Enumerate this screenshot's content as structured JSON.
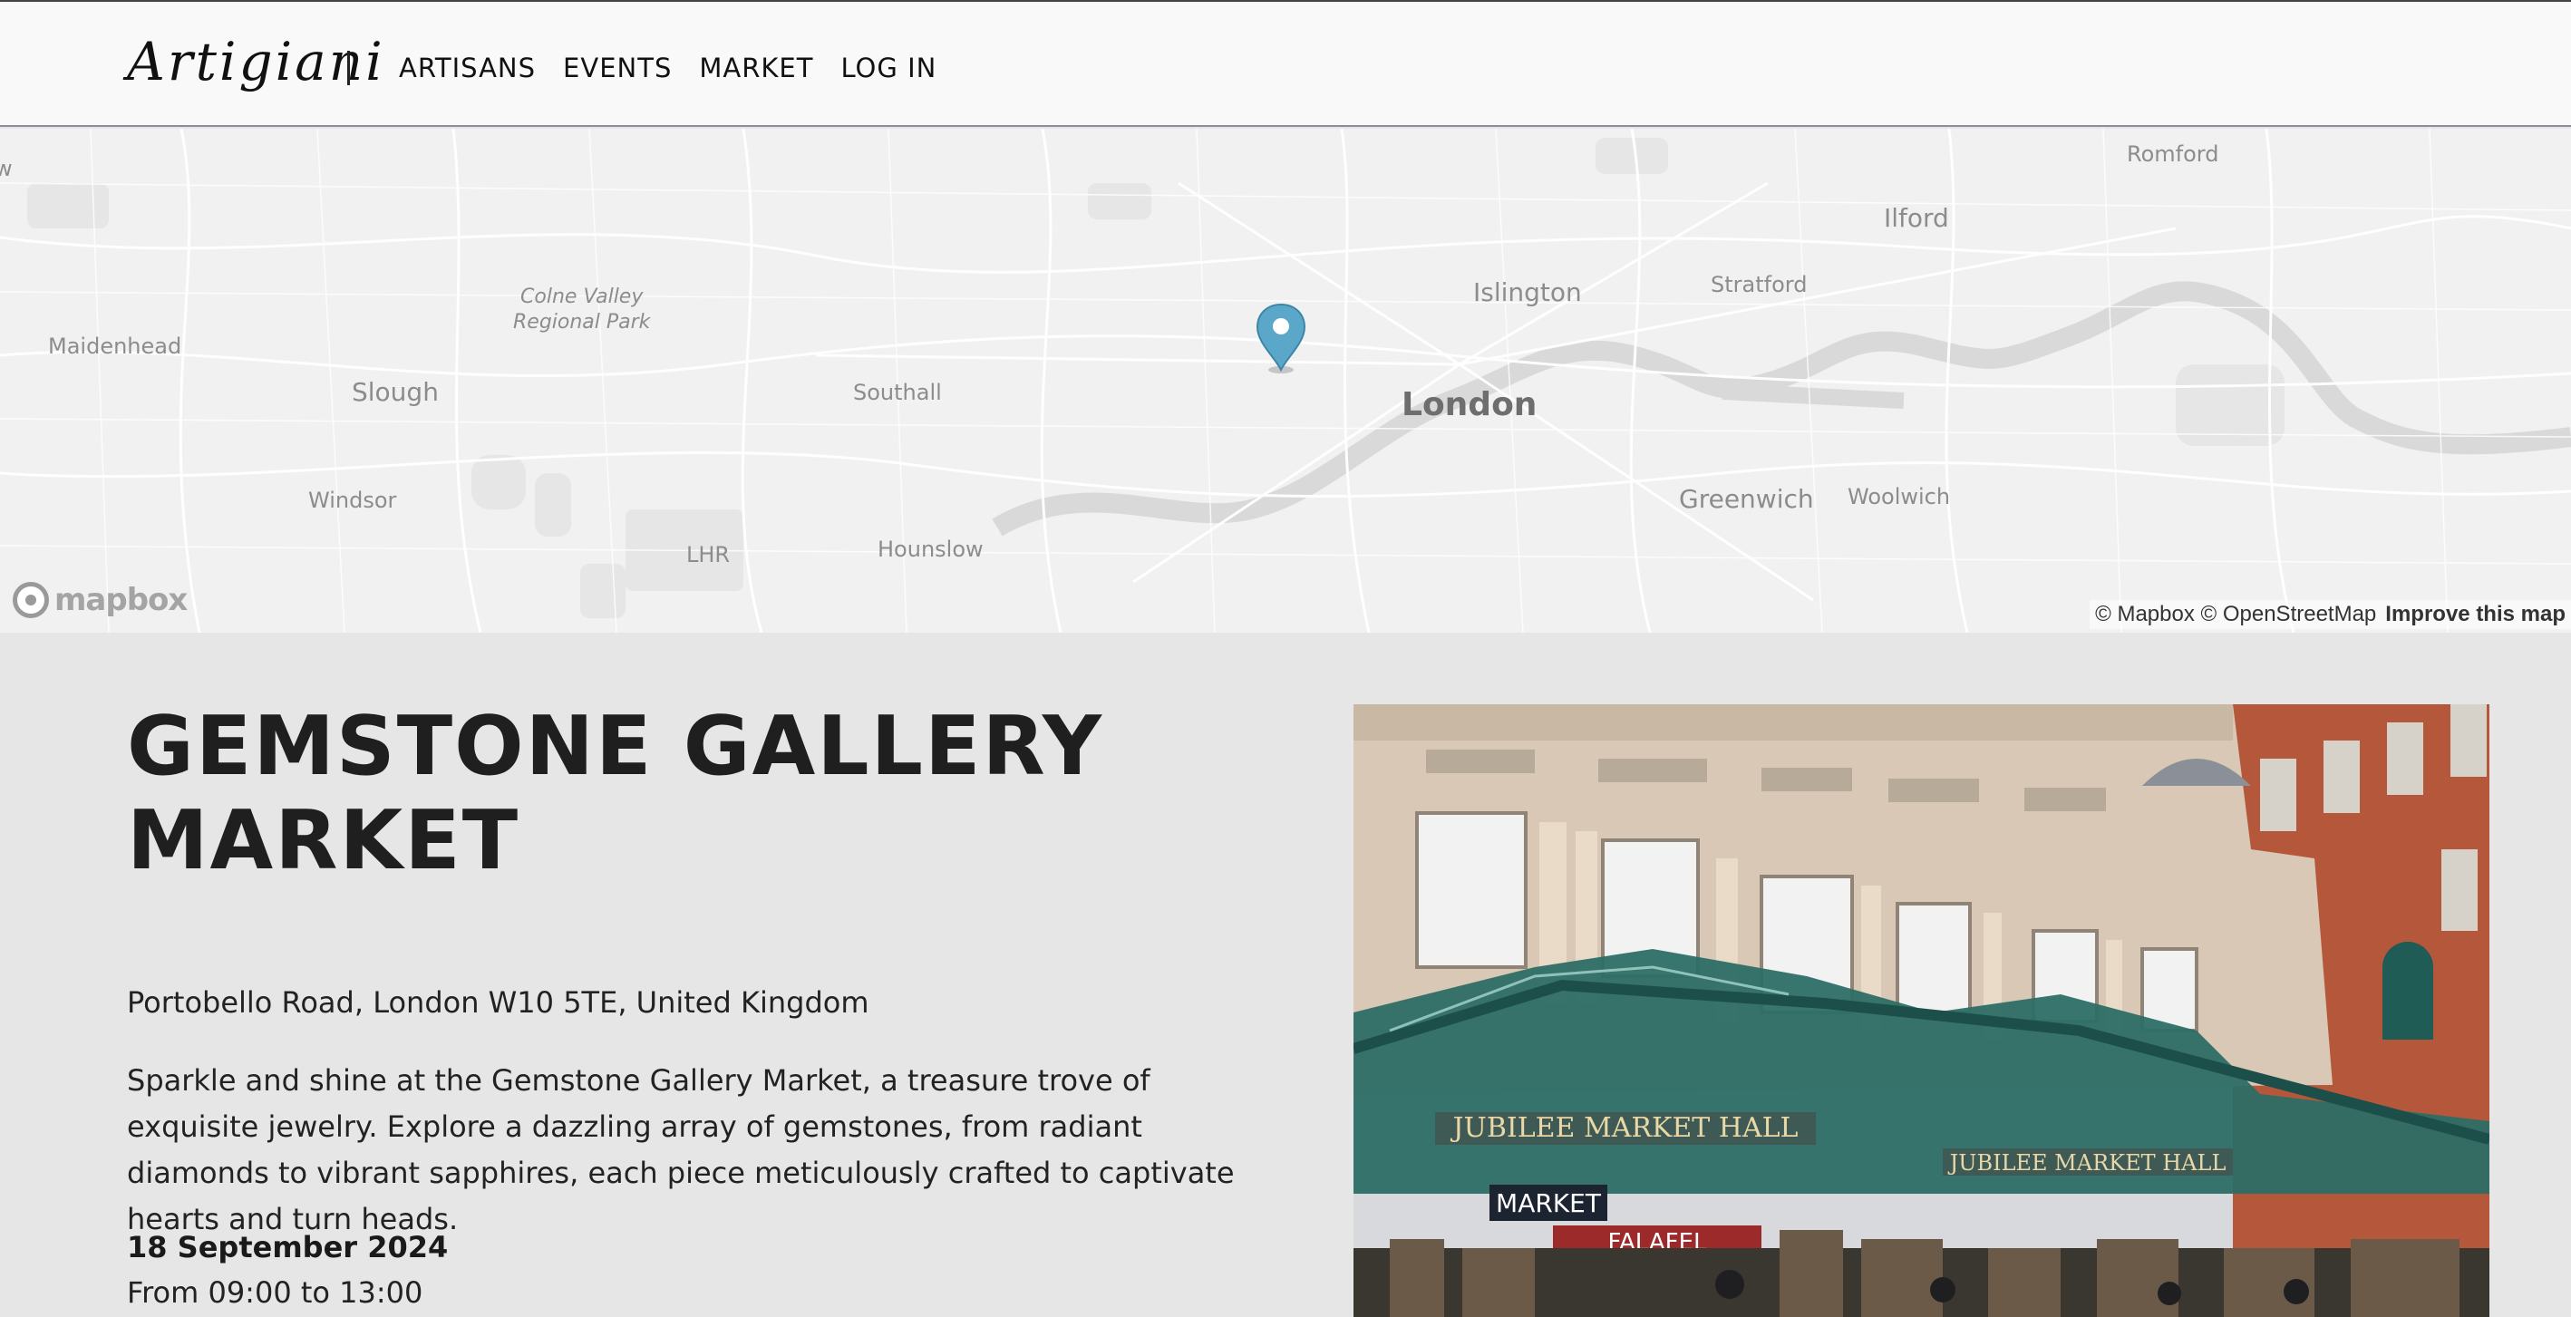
{
  "header": {
    "logo": "Artigiani",
    "nav": [
      "ARTISANS",
      "EVENTS",
      "MARKET",
      "LOG IN"
    ]
  },
  "map": {
    "labels": {
      "romford": "Romford",
      "ilford": "Ilford",
      "islington": "Islington",
      "stratford": "Stratford",
      "colne1": "Colne Valley",
      "colne2": "Regional Park",
      "maidenhead": "Maidenhead",
      "slough": "Slough",
      "southall": "Southall",
      "london": "London",
      "windsor": "Windsor",
      "greenwich": "Greenwich",
      "woolwich": "Woolwich",
      "lhr": "LHR",
      "hounslow": "Hounslow",
      "edge_w": "w"
    },
    "logo_text": "mapbox",
    "attribution": "© Mapbox © OpenStreetMap",
    "improve": "Improve this map",
    "marker_color": "#5aa7c9"
  },
  "event": {
    "title": "GEMSTONE GALLERY MARKET",
    "address": "Portobello Road, London W10 5TE, United Kingdom",
    "description": "Sparkle and shine at the Gemstone Gallery Market, a treasure trove of exquisite jewelry. Explore a dazzling array of gemstones, from radiant diamonds to vibrant sapphires, each piece meticulously crafted to captivate hearts and turn heads.",
    "date": "18 September 2024",
    "time": "From 09:00 to 13:00"
  },
  "photo": {
    "sign1": "JUBILEE MARKET HALL",
    "sign2": "JUBILEE MARKET HALL",
    "market_sign": "MARKET",
    "falafel_sign": "FALAFEL"
  }
}
